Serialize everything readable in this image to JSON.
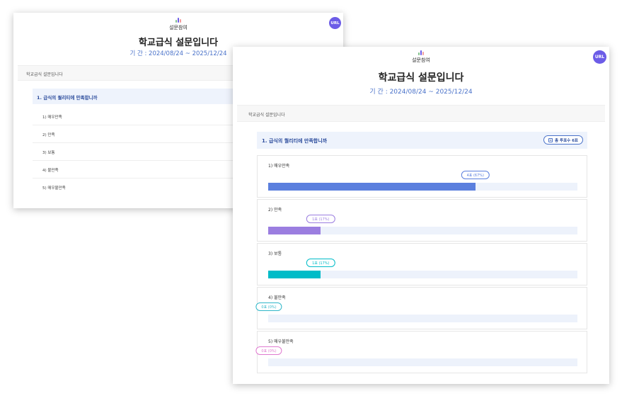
{
  "logo": {
    "text": "설문참여",
    "colors": [
      "#7dbf8a",
      "#6c5ce7",
      "#f39c9c"
    ]
  },
  "url_button": {
    "label": "URL",
    "color": "#6c5ce7"
  },
  "survey": {
    "title": "학교급식 설문입니다",
    "period": "기   간 : 2024/08/24 ~ 2025/12/24",
    "section_label": "학교급식 설문입니다"
  },
  "question": {
    "title": "1. 급식의 퀄리티에 만족합니까",
    "total_label": "총 투표수 6표",
    "options": [
      {
        "label": "1) 매우만족",
        "tip": "4표 (67%)",
        "percent": 67,
        "color": "#5b7fde"
      },
      {
        "label": "2) 만족",
        "tip": "1표 (17%)",
        "percent": 17,
        "color": "#9b7ee0"
      },
      {
        "label": "3) 보통",
        "tip": "1표 (17%)",
        "percent": 17,
        "color": "#00bcc8"
      },
      {
        "label": "4) 불만족",
        "tip": "0표 (0%)",
        "percent": 0,
        "color": "#31b7c9"
      },
      {
        "label": "5) 매우불만족",
        "tip": "0표 (0%)",
        "percent": 0,
        "color": "#e07ad0"
      }
    ]
  }
}
